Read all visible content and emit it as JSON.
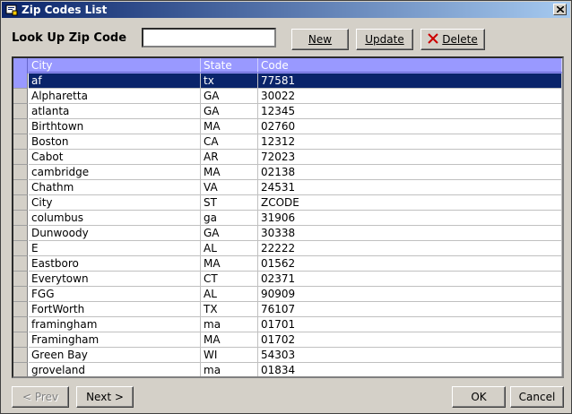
{
  "window": {
    "title": "Zip Codes List"
  },
  "lookup": {
    "label": "Look Up Zip Code",
    "value": ""
  },
  "toolbar": {
    "new_label": "New",
    "update_label": "Update",
    "delete_label": "Delete"
  },
  "grid": {
    "columns": [
      "City",
      "State",
      "Code"
    ],
    "rows": [
      {
        "city": "af",
        "state": "tx",
        "code": "77581"
      },
      {
        "city": "Alpharetta",
        "state": "GA",
        "code": "30022"
      },
      {
        "city": "atlanta",
        "state": "GA",
        "code": "12345"
      },
      {
        "city": "Birthtown",
        "state": "MA",
        "code": "02760"
      },
      {
        "city": "Boston",
        "state": "CA",
        "code": "12312"
      },
      {
        "city": "Cabot",
        "state": "AR",
        "code": "72023"
      },
      {
        "city": "cambridge",
        "state": "MA",
        "code": "02138"
      },
      {
        "city": "Chathm",
        "state": "VA",
        "code": "24531"
      },
      {
        "city": "City",
        "state": "ST",
        "code": "ZCODE"
      },
      {
        "city": "columbus",
        "state": "ga",
        "code": "31906"
      },
      {
        "city": "Dunwoody",
        "state": "GA",
        "code": "30338"
      },
      {
        "city": "E",
        "state": "AL",
        "code": "22222"
      },
      {
        "city": "Eastboro",
        "state": "MA",
        "code": "01562"
      },
      {
        "city": "Everytown",
        "state": "CT",
        "code": "02371"
      },
      {
        "city": "FGG",
        "state": "AL",
        "code": "90909"
      },
      {
        "city": "FortWorth",
        "state": "TX",
        "code": "76107"
      },
      {
        "city": "framingham",
        "state": "ma",
        "code": "01701"
      },
      {
        "city": "Framingham",
        "state": "MA",
        "code": "01702"
      },
      {
        "city": "Green Bay",
        "state": "WI",
        "code": "54303"
      },
      {
        "city": "groveland",
        "state": "ma",
        "code": "01834"
      }
    ]
  },
  "footer": {
    "prev_label": "< Prev",
    "next_label": "Next >",
    "ok_label": "OK",
    "cancel_label": "Cancel"
  },
  "colors": {
    "title_start": "#0a246a",
    "title_end": "#a6caf0",
    "header_bg": "#9999ff",
    "selected_row": "#0a246a",
    "face": "#d4d0c8",
    "delete_icon": "#cc0000"
  }
}
